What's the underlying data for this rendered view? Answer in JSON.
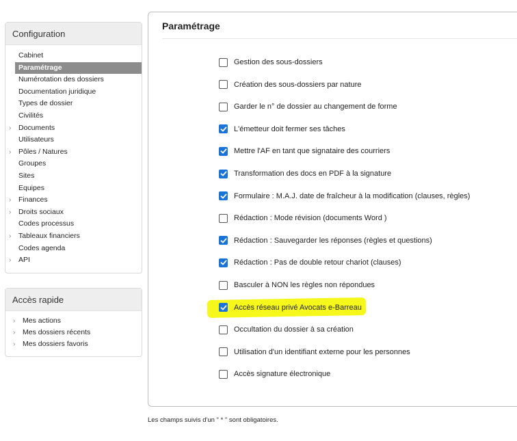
{
  "config_panel": {
    "title": "Configuration",
    "items": [
      {
        "label": "Cabinet",
        "chevron": false,
        "active": false
      },
      {
        "label": "Paramétrage",
        "chevron": false,
        "active": true
      },
      {
        "label": "Numérotation des dossiers",
        "chevron": false,
        "active": false
      },
      {
        "label": "Documentation juridique",
        "chevron": false,
        "active": false
      },
      {
        "label": "Types de dossier",
        "chevron": false,
        "active": false
      },
      {
        "label": "Civilités",
        "chevron": false,
        "active": false
      },
      {
        "label": "Documents",
        "chevron": true,
        "active": false
      },
      {
        "label": "Utilisateurs",
        "chevron": false,
        "active": false
      },
      {
        "label": "Pôles / Natures",
        "chevron": true,
        "active": false
      },
      {
        "label": "Groupes",
        "chevron": false,
        "active": false
      },
      {
        "label": "Sites",
        "chevron": false,
        "active": false
      },
      {
        "label": "Equipes",
        "chevron": false,
        "active": false
      },
      {
        "label": "Finances",
        "chevron": true,
        "active": false
      },
      {
        "label": "Droits sociaux",
        "chevron": true,
        "active": false
      },
      {
        "label": "Codes processus",
        "chevron": false,
        "active": false
      },
      {
        "label": "Tableaux financiers",
        "chevron": true,
        "active": false
      },
      {
        "label": "Codes agenda",
        "chevron": false,
        "active": false
      },
      {
        "label": "API",
        "chevron": true,
        "active": false
      }
    ]
  },
  "quick_panel": {
    "title": "Accès rapide",
    "items": [
      {
        "label": "Mes actions"
      },
      {
        "label": "Mes dossiers récents"
      },
      {
        "label": "Mes dossiers favoris"
      }
    ]
  },
  "main": {
    "title": "Paramétrage",
    "options": [
      {
        "label": "Gestion des sous-dossiers",
        "checked": false
      },
      {
        "label": "Création des sous-dossiers par nature",
        "checked": false
      },
      {
        "label": "Garder le n° de dossier au changement de forme",
        "checked": false
      },
      {
        "label": "L'émetteur doit fermer ses tâches",
        "checked": true
      },
      {
        "label": "Mettre l'AF en tant que signataire des courriers",
        "checked": true
      },
      {
        "label": "Transformation des docs en PDF à la signature",
        "checked": true
      },
      {
        "label": "Formulaire : M.A.J. date de fraîcheur à la modification (clauses, règles)",
        "checked": true
      },
      {
        "label": "Rédaction : Mode révision (documents Word )",
        "checked": false
      },
      {
        "label": "Rédaction : Sauvegarder les réponses (règles et questions)",
        "checked": true
      },
      {
        "label": "Rédaction : Pas de double retour chariot (clauses)",
        "checked": true
      },
      {
        "label": "Basculer à NON les règles non répondues",
        "checked": false
      },
      {
        "label": "Accès réseau privé Avocats e-Barreau",
        "checked": true,
        "highlighted": true
      },
      {
        "label": "Occultation du dossier à sa création",
        "checked": false
      },
      {
        "label": "Utilisation d'un identifiant externe pour les personnes",
        "checked": false
      },
      {
        "label": "Accès signature électronique",
        "checked": false
      }
    ],
    "footer_note": "Les champs suivis d'un \" * \" sont obligatoires."
  },
  "colors": {
    "checkbox_checked": "#1a73d6",
    "active_item_bg": "#8c8c8c",
    "highlight": "#f6f71a"
  }
}
